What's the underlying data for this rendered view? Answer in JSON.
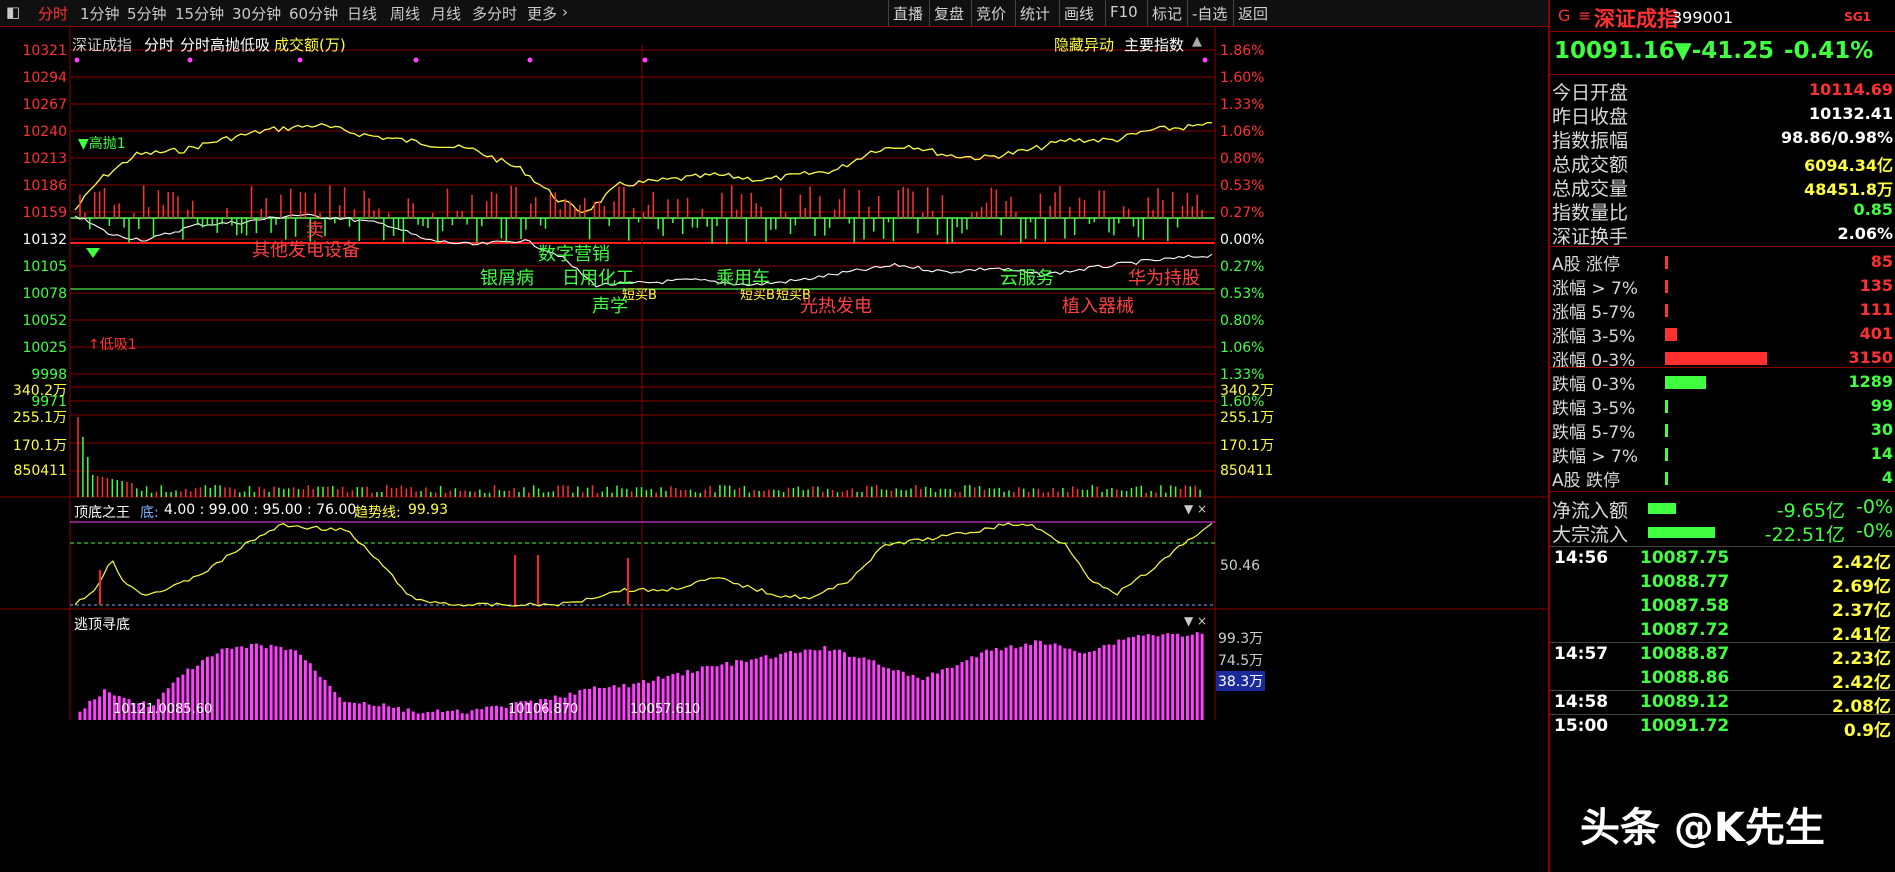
{
  "toolbar": {
    "tabs": [
      "分时",
      "1分钟",
      "5分钟",
      "15分钟",
      "30分钟",
      "60分钟",
      "日线",
      "周线",
      "月线",
      "多分时",
      "更多"
    ],
    "active_tab": "分时",
    "right_buttons": [
      "直播",
      "复盘",
      "竞价",
      "统计",
      "画线",
      "F10",
      "标记",
      "-自选",
      "返回"
    ]
  },
  "chart_header": {
    "index_name": "深证成指",
    "mode": "分时",
    "indicator": "分时高抛低吸",
    "volume_label": "成交额(万)",
    "hidden_alerts": "隐藏异动",
    "main_index": "主要指数"
  },
  "price_axis": {
    "left": [
      "10321",
      "10294",
      "10267",
      "10240",
      "10213",
      "10186",
      "10159",
      "10132",
      "10105",
      "10078",
      "10052",
      "10025",
      "9998",
      "9971"
    ],
    "right": [
      "1.86%",
      "1.60%",
      "1.33%",
      "1.06%",
      "0.80%",
      "0.53%",
      "0.27%",
      "0.00%",
      "0.27%",
      "0.53%",
      "0.80%",
      "1.06%",
      "1.33%",
      "1.60%"
    ],
    "prev_close": "10132"
  },
  "volume_axis": {
    "left": [
      "340.2万",
      "255.1万",
      "170.1万",
      "850411"
    ],
    "right": [
      "340.2万",
      "255.1万",
      "170.1万",
      "850411"
    ]
  },
  "markers": {
    "high_sell": "高抛1",
    "low_buy": "低吸1"
  },
  "sector_annotations": [
    {
      "text": "其他发电设备",
      "color": "#ff4040"
    },
    {
      "text": "卖",
      "color": "#ff4040"
    },
    {
      "text": "数字营销",
      "color": "#40ff40"
    },
    {
      "text": "银屑病",
      "color": "#40ff40"
    },
    {
      "text": "日用化工",
      "color": "#40ff40"
    },
    {
      "text": "乘用车",
      "color": "#40ff40"
    },
    {
      "text": "云服务",
      "color": "#40ff40"
    },
    {
      "text": "华为持股",
      "color": "#ff4040"
    },
    {
      "text": "声学",
      "color": "#40ff40"
    },
    {
      "text": "短买B",
      "color": "#ffff40"
    },
    {
      "text": "短买B",
      "color": "#ffff40"
    },
    {
      "text": "短买B",
      "color": "#ffff40"
    },
    {
      "text": "光热发电",
      "color": "#ff4040"
    },
    {
      "text": "植入器械",
      "color": "#ff4040"
    }
  ],
  "indicator1": {
    "name": "顶底之王",
    "params_label": "底:",
    "params": "4.00 : 99.00 : 95.00 : 76.00",
    "trend_label": "趋势线:",
    "trend_value": "99.93",
    "axis_value": "50.46"
  },
  "indicator2": {
    "name": "逃顶寻底",
    "axis": [
      "99.3万",
      "74.5万",
      "38.3万"
    ],
    "labels": [
      "10121.0085.60",
      "10106.870",
      "10057.610"
    ]
  },
  "quote": {
    "prefix": "G",
    "menu_icon": "≡",
    "name": "深证成指",
    "code": "399001",
    "badge": "SG1",
    "price": "10091.16",
    "change": "▼-41.25",
    "change_pct": "-0.41%"
  },
  "stats": [
    {
      "k": "今日开盘",
      "v": "10114.69",
      "c": "#ff3030"
    },
    {
      "k": "昨日收盘",
      "v": "10132.41",
      "c": "#ffffff"
    },
    {
      "k": "指数振幅",
      "v": "98.86/0.98%",
      "c": "#ffffff"
    },
    {
      "k": "总成交额",
      "v": "6094.34亿",
      "c": "#ffff40"
    },
    {
      "k": "总成交量",
      "v": "48451.8万",
      "c": "#ffff40"
    },
    {
      "k": "指数量比",
      "v": "0.85",
      "c": "#40ff40"
    },
    {
      "k": "深证换手",
      "v": "2.06%",
      "c": "#ffffff"
    }
  ],
  "breadth": [
    {
      "k": "A股 涨停",
      "v": "85",
      "bar": 0.02,
      "c": "#ff3030"
    },
    {
      "k": "涨幅 > 7%",
      "v": "135",
      "bar": 0.03,
      "c": "#ff3030"
    },
    {
      "k": "涨幅 5-7%",
      "v": "111",
      "bar": 0.025,
      "c": "#ff3030"
    },
    {
      "k": "涨幅 3-5%",
      "v": "401",
      "bar": 0.12,
      "c": "#ff3030"
    },
    {
      "k": "涨幅 0-3%",
      "v": "3150",
      "bar": 1.0,
      "c": "#ff3030"
    },
    {
      "k": "跌幅 0-3%",
      "v": "1289",
      "bar": 0.4,
      "c": "#40ff40"
    },
    {
      "k": "跌幅 3-5%",
      "v": "99",
      "bar": 0.03,
      "c": "#40ff40"
    },
    {
      "k": "跌幅 5-7%",
      "v": "30",
      "bar": 0.01,
      "c": "#40ff40"
    },
    {
      "k": "跌幅 > 7%",
      "v": "14",
      "bar": 0.005,
      "c": "#40ff40"
    },
    {
      "k": "A股 跌停",
      "v": "4",
      "bar": 0.002,
      "c": "#40ff40"
    }
  ],
  "flows": [
    {
      "k": "净流入额",
      "v": "-9.65亿",
      "p": "-0%",
      "bar": 0.25
    },
    {
      "k": "大宗流入",
      "v": "-22.51亿",
      "p": "-0%",
      "bar": 0.6
    }
  ],
  "minutes": [
    {
      "t": "14:56",
      "p": "10087.75",
      "a": "2.42亿"
    },
    {
      "t": "",
      "p": "10088.77",
      "a": "2.69亿"
    },
    {
      "t": "",
      "p": "10087.58",
      "a": "2.37亿"
    },
    {
      "t": "",
      "p": "10087.72",
      "a": "2.41亿"
    },
    {
      "t": "14:57",
      "p": "10088.87",
      "a": "2.23亿"
    },
    {
      "t": "",
      "p": "10088.86",
      "a": "2.42亿"
    },
    {
      "t": "14:58",
      "p": "10089.12",
      "a": "2.08亿"
    },
    {
      "t": "15:00",
      "p": "10091.72",
      "a": "0.9亿"
    }
  ],
  "watermark": "头条 @K先生",
  "colors": {
    "up": "#ff3030",
    "down": "#40ff40",
    "grid": "#8a0000",
    "price_line": "#ffff40",
    "avg_line": "#ffffff",
    "magenta": "#ff40ff"
  }
}
